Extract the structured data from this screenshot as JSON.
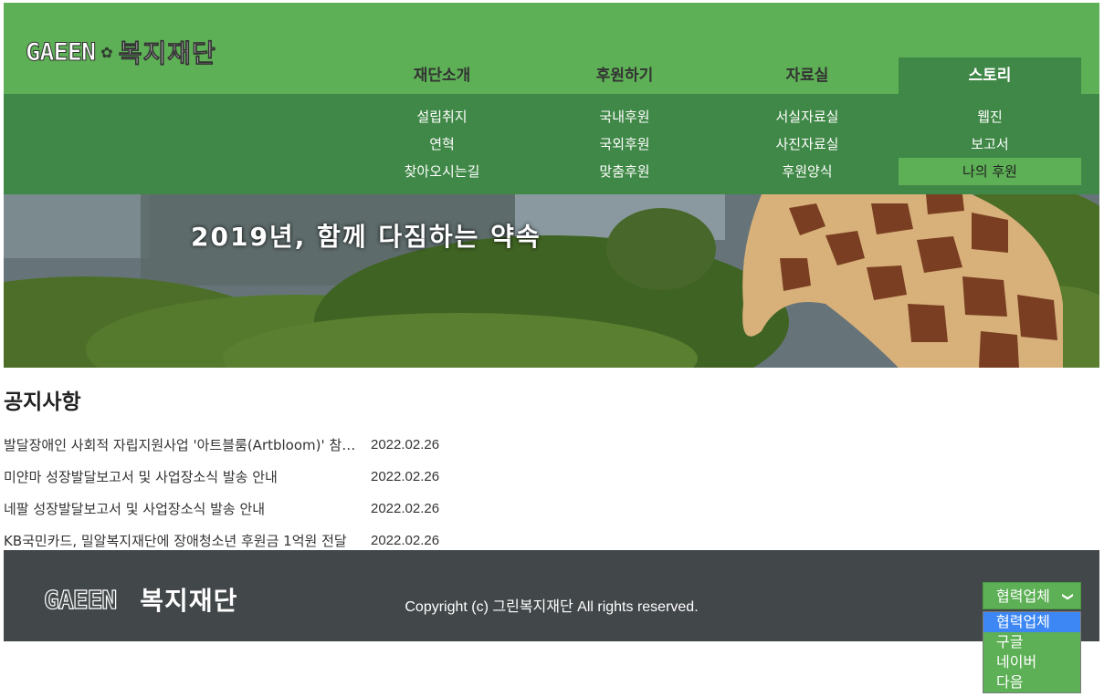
{
  "header": {
    "logo_en": "GAEEN",
    "logo_kr": "복지재단",
    "nav": [
      {
        "label": "재단소개",
        "active": false,
        "sub": [
          "설립취지",
          "연혁",
          "찾아오시는길"
        ]
      },
      {
        "label": "후원하기",
        "active": false,
        "sub": [
          "국내후원",
          "국외후원",
          "맞춤후원"
        ]
      },
      {
        "label": "자료실",
        "active": false,
        "sub": [
          "서실자료실",
          "사진자료실",
          "후원양식"
        ]
      },
      {
        "label": "스토리",
        "active": true,
        "sub": [
          "웹진",
          "보고서",
          "나의 후원"
        ]
      }
    ],
    "highlighted_sub": "나의 후원"
  },
  "banner": {
    "text": "2019년, 함께 다짐하는 약속"
  },
  "notice": {
    "title": "공지사항",
    "items": [
      {
        "subject": "발달장애인 사회적 자립지원사업 '아트블룸(Artbloom)' 참가자 모집",
        "date": "2022.02.26"
      },
      {
        "subject": "미얀마 성장발달보고서 및 사업장소식 발송 안내",
        "date": "2022.02.26"
      },
      {
        "subject": "네팔 성장발달보고서 및 사업장소식 발송 안내",
        "date": "2022.02.26"
      },
      {
        "subject": "KB국민카드, 밀알복지재단에 장애청소년 후원금 1억원 전달",
        "date": "2022.02.26"
      }
    ]
  },
  "footer": {
    "logo_en": "GAEEN",
    "logo_kr": "복지재단",
    "copyright": "Copyright (c) 그린복지재단 All rights reserved.",
    "select_value": "협력업체",
    "select_options": [
      "협력업체",
      "구글",
      "네이버",
      "다음"
    ]
  },
  "colors": {
    "header_green": "#5db055",
    "menu_dark_green": "#408847",
    "footer_gray": "#424749",
    "option_highlight": "#3d87f5"
  }
}
